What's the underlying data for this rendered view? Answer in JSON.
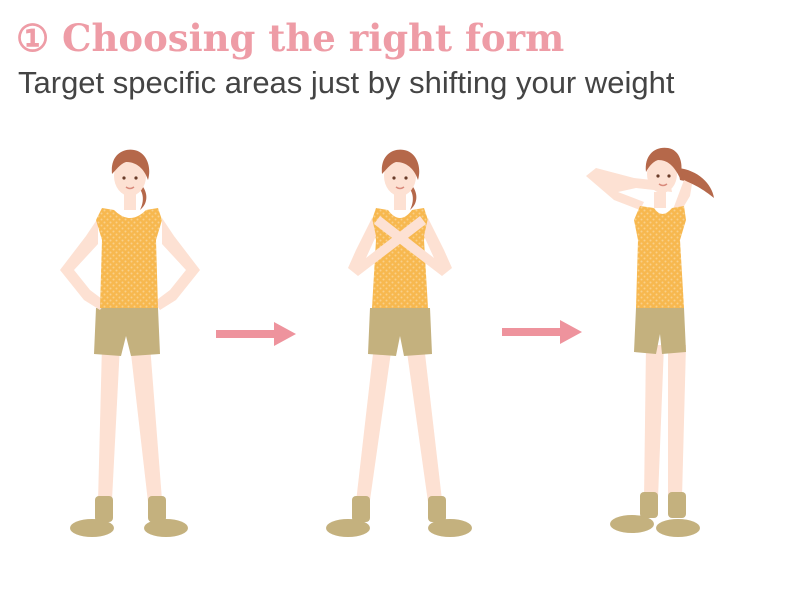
{
  "header": {
    "title": "① Choosing the right form",
    "subtitle": "Target specific areas just by shifting your weight"
  },
  "illustration": {
    "poses": [
      "hands-on-hips",
      "arms-crossed-on-chest",
      "arm-behind-head"
    ],
    "colors": {
      "skin": "#fde1d3",
      "skin_shade": "#f3c7b4",
      "hair": "#b5684a",
      "top": "#f7b84f",
      "top_dots": "#f9d089",
      "shorts": "#c4b17e",
      "socks": "#c4b17e",
      "arrow": "#ee939d"
    },
    "arrows": [
      "arrow-right-icon",
      "arrow-right-icon"
    ]
  }
}
